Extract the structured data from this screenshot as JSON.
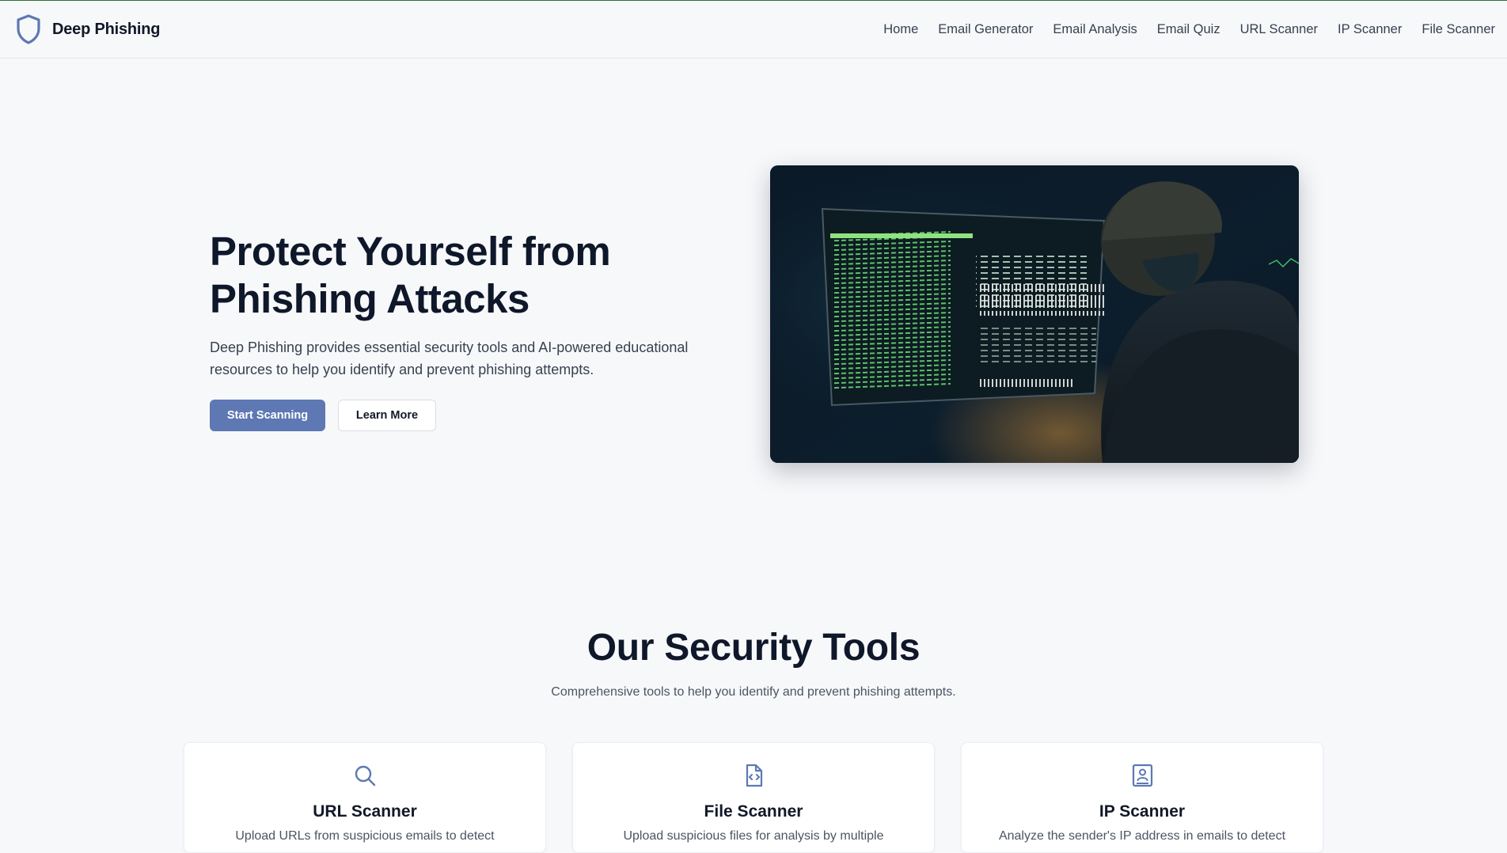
{
  "brand": {
    "name": "Deep Phishing",
    "logo_icon": "shield-icon"
  },
  "nav": {
    "items": [
      "Home",
      "Email Generator",
      "Email Analysis",
      "Email Quiz",
      "URL Scanner",
      "IP Scanner",
      "File Scanner"
    ]
  },
  "hero": {
    "title_line1": "Protect Yourself from",
    "title_line2": "Phishing Attacks",
    "description": "Deep Phishing provides essential security tools and AI-powered educational resources to help you identify and prevent phishing attempts.",
    "primary_button": "Start Scanning",
    "secondary_button": "Learn More"
  },
  "tools": {
    "title": "Our Security Tools",
    "subtitle": "Comprehensive tools to help you identify and prevent phishing attempts.",
    "cards": [
      {
        "icon": "search-icon",
        "title": "URL Scanner",
        "description": "Upload URLs from suspicious emails to detect"
      },
      {
        "icon": "file-code-icon",
        "title": "File Scanner",
        "description": "Upload suspicious files for analysis by multiple"
      },
      {
        "icon": "contact-book-icon",
        "title": "IP Scanner",
        "description": "Analyze the sender's IP address in emails to detect"
      }
    ]
  },
  "colors": {
    "accent": "#5d78b3",
    "text": "#0f172a",
    "background": "#f7f8fa"
  }
}
